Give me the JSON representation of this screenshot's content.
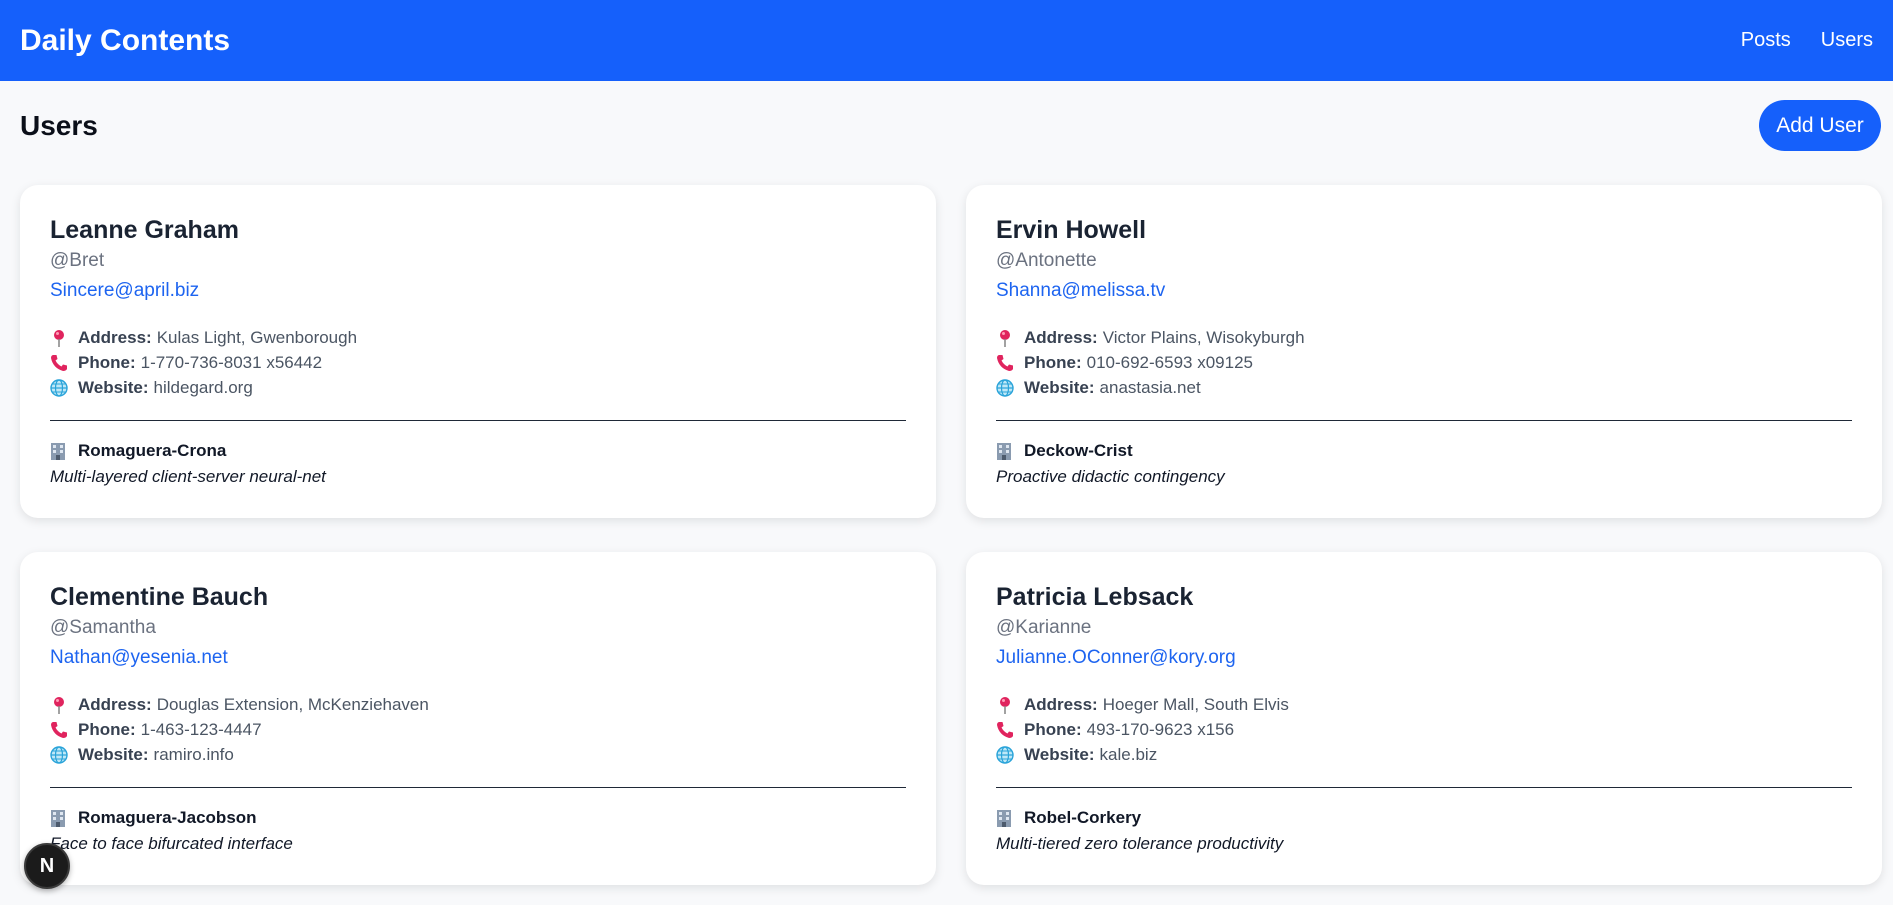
{
  "header": {
    "brand": "Daily Contents",
    "nav": [
      "Posts",
      "Users"
    ]
  },
  "page": {
    "title": "Users",
    "add_button": "Add User"
  },
  "labels": {
    "address": "Address:",
    "phone": "Phone:",
    "website": "Website:"
  },
  "users": [
    {
      "name": "Leanne Graham",
      "username": "@Bret",
      "email": "Sincere@april.biz",
      "address": "Kulas Light, Gwenborough",
      "phone": "1-770-736-8031 x56442",
      "website": "hildegard.org",
      "company": "Romaguera-Crona",
      "catchphrase": "Multi-layered client-server neural-net"
    },
    {
      "name": "Ervin Howell",
      "username": "@Antonette",
      "email": "Shanna@melissa.tv",
      "address": "Victor Plains, Wisokyburgh",
      "phone": "010-692-6593 x09125",
      "website": "anastasia.net",
      "company": "Deckow-Crist",
      "catchphrase": "Proactive didactic contingency"
    },
    {
      "name": "Clementine Bauch",
      "username": "@Samantha",
      "email": "Nathan@yesenia.net",
      "address": "Douglas Extension, McKenziehaven",
      "phone": "1-463-123-4447",
      "website": "ramiro.info",
      "company": "Romaguera-Jacobson",
      "catchphrase": "Face to face bifurcated interface"
    },
    {
      "name": "Patricia Lebsack",
      "username": "@Karianne",
      "email": "Julianne.OConner@kory.org",
      "address": "Hoeger Mall, South Elvis",
      "phone": "493-170-9623 x156",
      "website": "kale.biz",
      "company": "Robel-Corkery",
      "catchphrase": "Multi-tiered zero tolerance productivity"
    }
  ],
  "badge": "N",
  "colors": {
    "primary": "#1560fb",
    "link": "#1d64f0",
    "pin": "#e0245e",
    "globe": "#29a3d9",
    "building": "#8a9bb0"
  },
  "icons": {
    "address": "round-pushpin-icon",
    "phone": "telephone-receiver-icon",
    "website": "globe-icon",
    "company": "office-building-icon"
  }
}
